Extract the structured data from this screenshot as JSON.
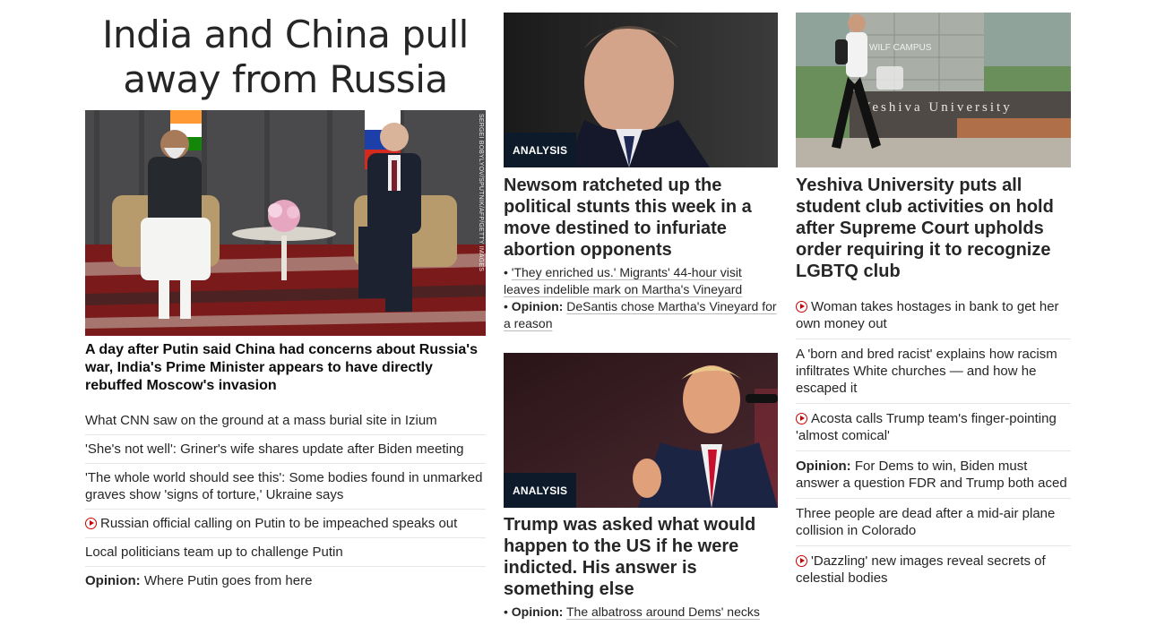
{
  "col1": {
    "headline": "India and China pull away from Russia",
    "image_credit": "SERGEI BOBYLYOV/SPUTNIK/AFP/GETTY IMAGES",
    "lead_caption": "A day after Putin said China had concerns about Russia's war, India's Prime Minister appears to have directly rebuffed Moscow's invasion",
    "items": [
      {
        "text": "What CNN saw on the ground at a mass burial site in Izium",
        "video": false
      },
      {
        "text": "'She's not well': Griner's wife shares update after Biden meeting",
        "video": false
      },
      {
        "text": "'The whole world should see this': Some bodies found in unmarked graves show 'signs of torture,' Ukraine says",
        "video": false
      },
      {
        "text": "Russian official calling on Putin to be impeached speaks out",
        "video": true
      },
      {
        "text": "Local politicians team up to challenge Putin",
        "video": false
      },
      {
        "prefix": "Opinion:",
        "text": " Where Putin goes from here",
        "video": false
      }
    ]
  },
  "col2": {
    "story1": {
      "badge": "ANALYSIS",
      "headline": "Newsom ratcheted up the political stunts this week in a move destined to infuriate abortion opponents",
      "bullets": [
        {
          "prefix": "",
          "text": "'They enriched us.' Migrants' 44-hour visit leaves indelible mark on Martha's Vineyard"
        },
        {
          "prefix": "Opinion:",
          "text": "DeSantis chose Martha's Vineyard for a reason"
        }
      ]
    },
    "story2": {
      "badge": "ANALYSIS",
      "headline": "Trump was asked what would happen to the US if he were indicted. His answer is something else",
      "bullets": [
        {
          "prefix": "Opinion:",
          "text": "The albatross around Dems' necks"
        }
      ]
    }
  },
  "col3": {
    "sign_text": "Yeshiva University",
    "sign_small": "WILF CAMPUS",
    "headline": "Yeshiva University puts all student club activities on hold after Supreme Court upholds order requiring it to recognize LGBTQ club",
    "items": [
      {
        "text": "Woman takes hostages in bank to get her own money out",
        "video": true
      },
      {
        "text": "A 'born and bred racist' explains how racism infiltrates White churches — and how he escaped it",
        "video": false
      },
      {
        "text": "Acosta calls Trump team's finger-pointing 'almost comical'",
        "video": true
      },
      {
        "prefix": "Opinion:",
        "text": " For Dems to win, Biden must answer a question FDR and Trump both aced",
        "video": false
      },
      {
        "text": "Three people are dead after a mid-air plane collision in Colorado",
        "video": false
      },
      {
        "text": "'Dazzling' new images reveal secrets of celestial bodies",
        "video": true
      }
    ]
  },
  "colors": {
    "video_icon": "#cc0000",
    "badge_bg": "#0c1a2a",
    "divider": "#e6e6e6"
  }
}
